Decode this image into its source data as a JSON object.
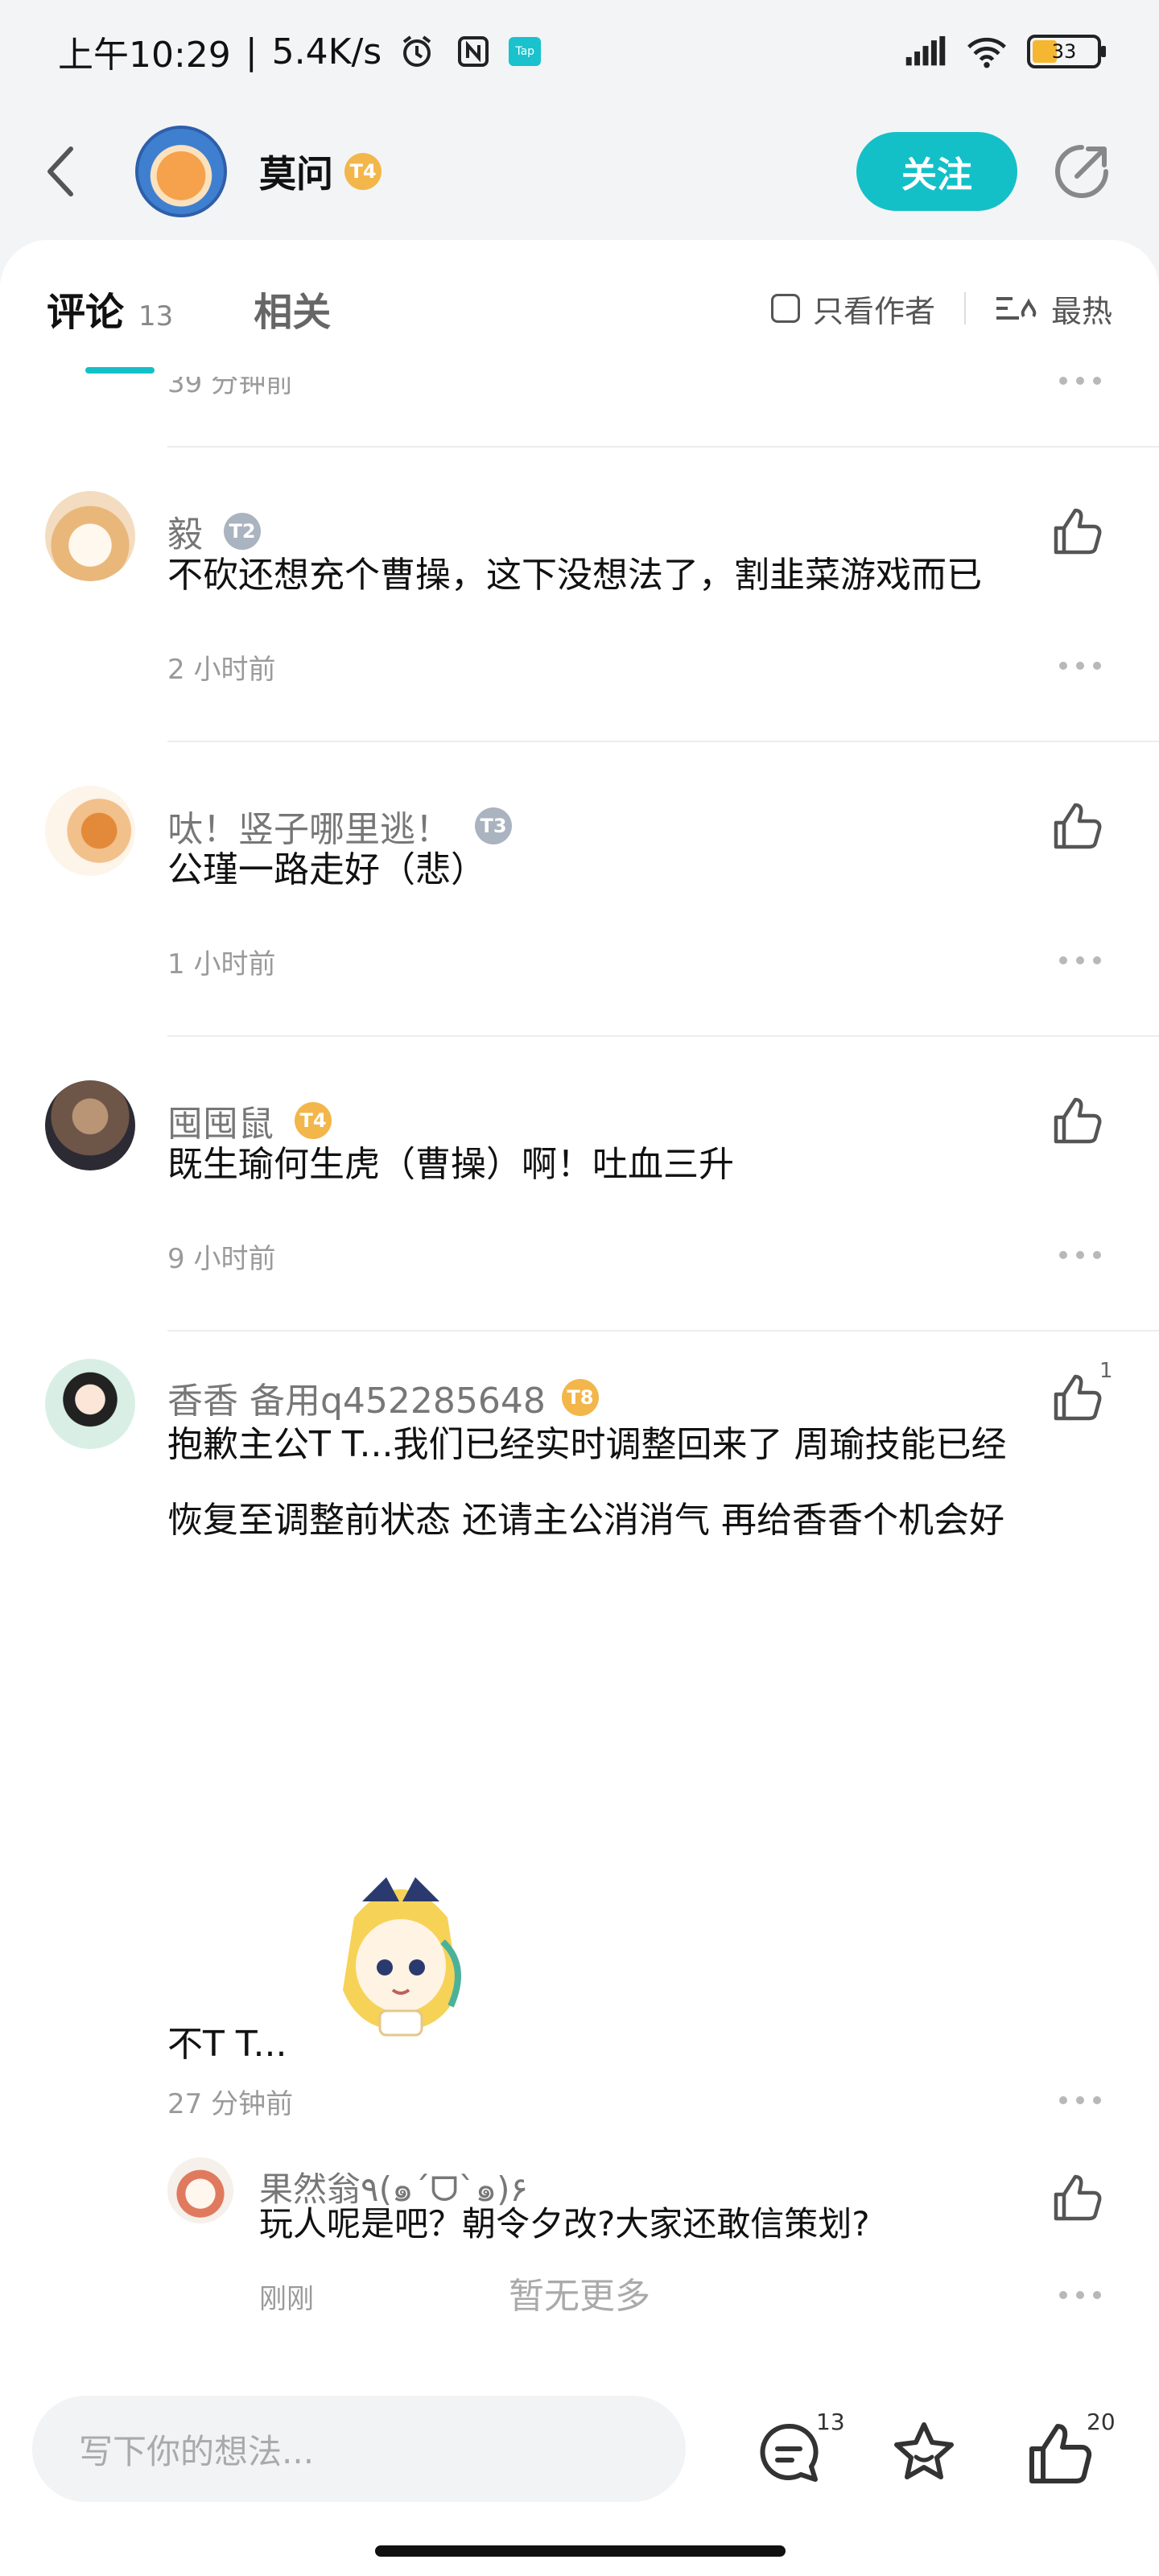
{
  "status_bar": {
    "time": "上午10:29",
    "separator": "|",
    "speed": "5.4K/s",
    "battery": "33",
    "tap_label": "Tap"
  },
  "header": {
    "name": "莫问",
    "badge": "T4",
    "follow_label": "关注"
  },
  "tabs": {
    "comments_label": "评论",
    "comments_count": "13",
    "related_label": "相关",
    "author_only_label": "只看作者",
    "sort_label": "最热"
  },
  "partial_comment": {
    "time": "39 分钟前"
  },
  "comments": [
    {
      "author": "毅",
      "badge": "T2",
      "text": "不砍还想充个曹操，这下没想法了，割韭菜游戏而已",
      "time": "2 小时前"
    },
    {
      "author": "呔！竖子哪里逃！",
      "badge": "T3",
      "text": "公瑾一路走好（悲）",
      "time": "1 小时前"
    },
    {
      "author": "囤囤鼠",
      "badge": "T4",
      "text": "既生瑜何生虎（曹操）啊！吐血三升",
      "time": "9 小时前"
    },
    {
      "author": "香香 备用q452285648",
      "badge": "T8",
      "text_line1": "抱歉主公T T...我们已经实时调整回来了 周瑜技能已经",
      "text_line2": "恢复至调整前状态 还请主公消消气 再给香香个机会好",
      "text_line3": "不T T...",
      "time": "27 分钟前",
      "likes": "1"
    }
  ],
  "reply": {
    "author": "果然翁٩(๑´ᗜ`๑)۶",
    "text": "玩人呢是吧？朝令夕改?大家还敢信策划?",
    "time": "刚刚"
  },
  "footer": {
    "no_more": "暂无更多",
    "placeholder": "写下你的想法...",
    "comment_count": "13",
    "like_count": "20"
  },
  "colors": {
    "accent": "#14c0c7",
    "gold_badge": "#f2b64a",
    "silver_badge": "#aab3c0"
  }
}
